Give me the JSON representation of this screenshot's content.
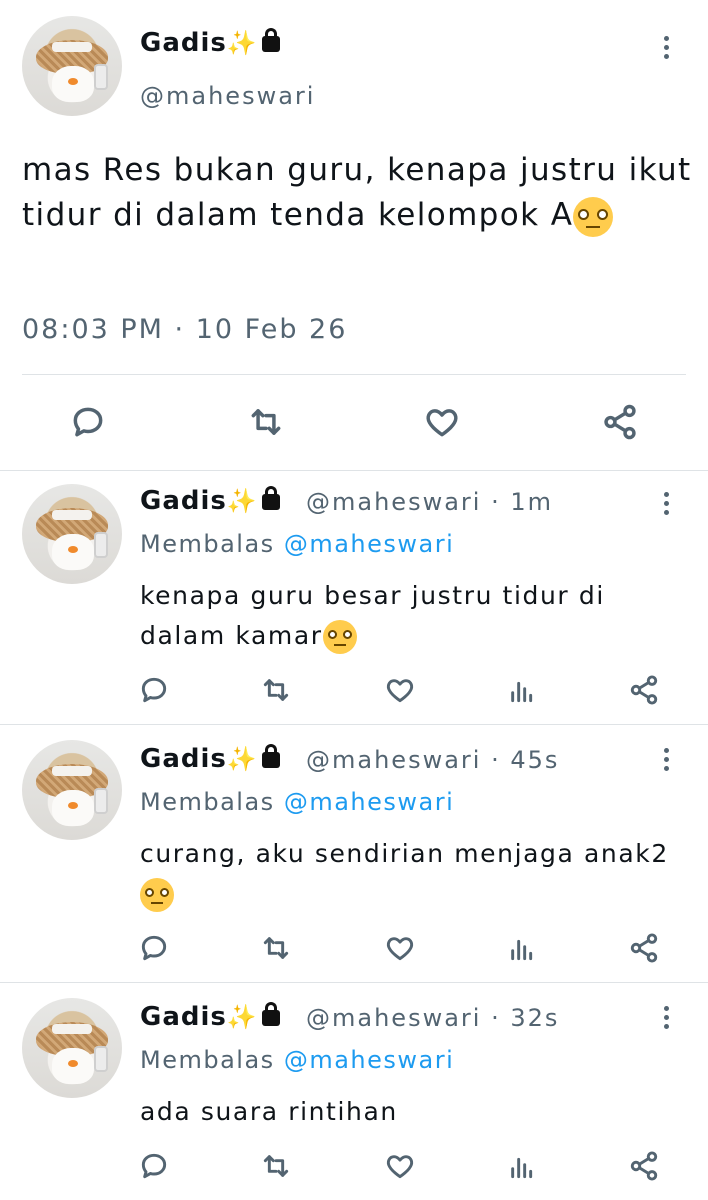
{
  "main_tweet": {
    "display_name": "Gadis",
    "handle": "@maheswari",
    "text": "mas Res bukan guru, kenapa justru ikut tidur di dalam tenda kelompok A",
    "timestamp": "08:03 PM · 10 Feb 26",
    "icons": [
      "sparkles-icon",
      "lock-icon",
      "more-icon",
      "reply-icon",
      "retweet-icon",
      "like-icon",
      "share-icon"
    ]
  },
  "replies": [
    {
      "display_name": "Gadis",
      "handle": "@maheswari",
      "time": "· 1m",
      "reply_label": "Membalas",
      "reply_mention": "@maheswari",
      "text": "kenapa guru besar justru tidur di dalam kamar"
    },
    {
      "display_name": "Gadis",
      "handle": "@maheswari",
      "time": "· 45s",
      "reply_label": "Membalas",
      "reply_mention": "@maheswari",
      "text": "curang, aku sendirian menjaga anak2"
    },
    {
      "display_name": "Gadis",
      "handle": "@maheswari",
      "time": "· 32s",
      "reply_label": "Membalas",
      "reply_mention": "@maheswari",
      "text": "ada suara rintihan"
    }
  ],
  "colors": {
    "text": "#0f1419",
    "secondary": "#536471",
    "link": "#1d9bf0",
    "divider": "#dfe3e6"
  }
}
